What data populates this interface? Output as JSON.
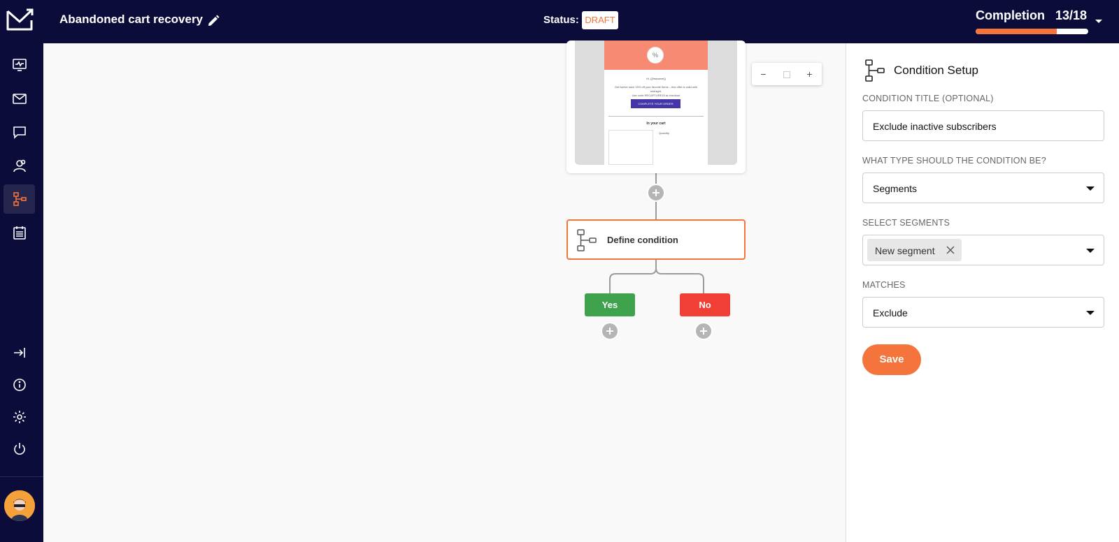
{
  "header": {
    "title": "Abandoned cart recovery",
    "status_label": "Status:",
    "status_value": "DRAFT",
    "completion_label": "Completion",
    "completion_count": "13/18",
    "completion_progress": 0.72,
    "accent_color": "#f4743b",
    "background_color": "#0c0c3a"
  },
  "sidebar": {
    "items": [
      {
        "icon": "monitor-icon"
      },
      {
        "icon": "envelope-icon"
      },
      {
        "icon": "chat-bubble-icon"
      },
      {
        "icon": "contacts-icon"
      },
      {
        "icon": "automation-flow-icon",
        "active": true
      },
      {
        "icon": "calendar-icon"
      }
    ],
    "bottom_items": [
      {
        "icon": "collapse-icon"
      },
      {
        "icon": "info-icon"
      },
      {
        "icon": "gear-icon"
      },
      {
        "icon": "power-icon"
      }
    ]
  },
  "canvas": {
    "email_preview": {
      "greeting": "Hi, {{firstname}}",
      "body_line1": "Get twelve save 15% off your favorite items – this offer is valid until midnight.",
      "body_line2": "Use code RECAPTURE15 at checkout",
      "cta": "COMPLETE YOUR ORDER",
      "section": "In your cart",
      "quantity": "Quantity"
    },
    "condition_node": {
      "label": "Define condition"
    },
    "branches": {
      "yes": "Yes",
      "no": "No"
    },
    "zoom": {
      "out": "−",
      "in": "+"
    }
  },
  "panel": {
    "title": "Condition Setup",
    "condition_title": {
      "label": "CONDITION TITLE (OPTIONAL)",
      "value": "Exclude inactive subscribers"
    },
    "condition_type": {
      "label": "WHAT TYPE SHOULD THE CONDITION BE?",
      "value": "Segments"
    },
    "segments": {
      "label": "SELECT SEGMENTS",
      "chips": [
        "New segment"
      ]
    },
    "matches": {
      "label": "MATCHES",
      "value": "Exclude"
    },
    "save_label": "Save"
  }
}
